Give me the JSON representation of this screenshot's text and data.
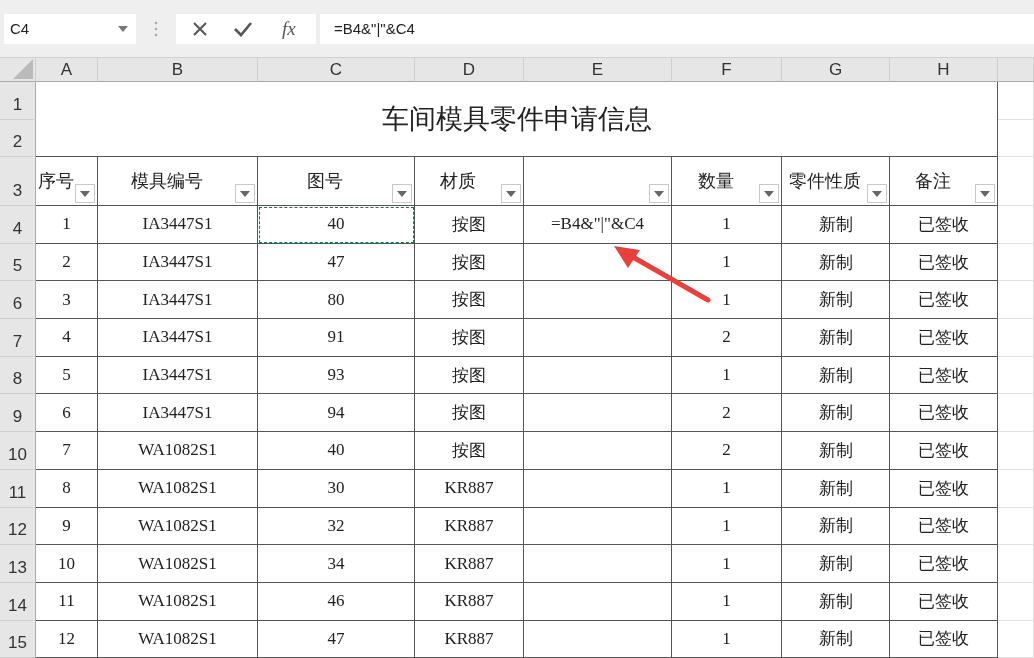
{
  "name_box": {
    "value": "C4"
  },
  "formula_bar": {
    "function_label": "fx",
    "formula": "=B4&\"|\"&C4"
  },
  "column_headers": [
    "A",
    "B",
    "C",
    "D",
    "E",
    "F",
    "G",
    "H"
  ],
  "row_headers": [
    "1",
    "2",
    "3",
    "4",
    "5",
    "6",
    "7",
    "8",
    "9",
    "10",
    "11",
    "12",
    "13",
    "14",
    "15"
  ],
  "title": "车间模具零件申请信息",
  "table": {
    "columns": [
      {
        "label": "序号"
      },
      {
        "label": "模具编号"
      },
      {
        "label": "图号"
      },
      {
        "label": "材质"
      },
      {},
      {
        "label": "数量"
      },
      {
        "label": "零件性质"
      },
      {
        "label": "备注"
      }
    ],
    "rows": [
      {
        "cells": [
          {
            "text": "1",
            "marquee": false
          },
          {
            "text": "IA3447S1",
            "marquee": false
          },
          {
            "text": "40",
            "marquee": true
          },
          {
            "text": "按图",
            "marquee": false
          },
          {
            "text": "=B4&\"|\"&C4",
            "marquee": false
          },
          {
            "text": "1",
            "marquee": false
          },
          {
            "text": "新制",
            "marquee": false
          },
          {
            "text": "已签收",
            "marquee": false
          }
        ]
      },
      {
        "cells": [
          {
            "text": "2",
            "marquee": false
          },
          {
            "text": "IA3447S1",
            "marquee": false
          },
          {
            "text": "47",
            "marquee": false
          },
          {
            "text": "按图",
            "marquee": false
          },
          {
            "marquee": false
          },
          {
            "text": "1",
            "marquee": false
          },
          {
            "text": "新制",
            "marquee": false
          },
          {
            "text": "已签收",
            "marquee": false
          }
        ]
      },
      {
        "cells": [
          {
            "text": "3",
            "marquee": false
          },
          {
            "text": "IA3447S1",
            "marquee": false
          },
          {
            "text": "80",
            "marquee": false
          },
          {
            "text": "按图",
            "marquee": false
          },
          {
            "marquee": false
          },
          {
            "text": "1",
            "marquee": false
          },
          {
            "text": "新制",
            "marquee": false
          },
          {
            "text": "已签收",
            "marquee": false
          }
        ]
      },
      {
        "cells": [
          {
            "text": "4",
            "marquee": false
          },
          {
            "text": "IA3447S1",
            "marquee": false
          },
          {
            "text": "91",
            "marquee": false
          },
          {
            "text": "按图",
            "marquee": false
          },
          {
            "marquee": false
          },
          {
            "text": "2",
            "marquee": false
          },
          {
            "text": "新制",
            "marquee": false
          },
          {
            "text": "已签收",
            "marquee": false
          }
        ]
      },
      {
        "cells": [
          {
            "text": "5",
            "marquee": false
          },
          {
            "text": "IA3447S1",
            "marquee": false
          },
          {
            "text": "93",
            "marquee": false
          },
          {
            "text": "按图",
            "marquee": false
          },
          {
            "marquee": false
          },
          {
            "text": "1",
            "marquee": false
          },
          {
            "text": "新制",
            "marquee": false
          },
          {
            "text": "已签收",
            "marquee": false
          }
        ]
      },
      {
        "cells": [
          {
            "text": "6",
            "marquee": false
          },
          {
            "text": "IA3447S1",
            "marquee": false
          },
          {
            "text": "94",
            "marquee": false
          },
          {
            "text": "按图",
            "marquee": false
          },
          {
            "marquee": false
          },
          {
            "text": "2",
            "marquee": false
          },
          {
            "text": "新制",
            "marquee": false
          },
          {
            "text": "已签收",
            "marquee": false
          }
        ]
      },
      {
        "cells": [
          {
            "text": "7",
            "marquee": false
          },
          {
            "text": "WA1082S1",
            "marquee": false
          },
          {
            "text": "40",
            "marquee": false
          },
          {
            "text": "按图",
            "marquee": false
          },
          {
            "marquee": false
          },
          {
            "text": "2",
            "marquee": false
          },
          {
            "text": "新制",
            "marquee": false
          },
          {
            "text": "已签收",
            "marquee": false
          }
        ]
      },
      {
        "cells": [
          {
            "text": "8",
            "marquee": false
          },
          {
            "text": "WA1082S1",
            "marquee": false
          },
          {
            "text": "30",
            "marquee": false
          },
          {
            "text": "KR887",
            "marquee": false
          },
          {
            "marquee": false
          },
          {
            "text": "1",
            "marquee": false
          },
          {
            "text": "新制",
            "marquee": false
          },
          {
            "text": "已签收",
            "marquee": false
          }
        ]
      },
      {
        "cells": [
          {
            "text": "9",
            "marquee": false
          },
          {
            "text": "WA1082S1",
            "marquee": false
          },
          {
            "text": "32",
            "marquee": false
          },
          {
            "text": "KR887",
            "marquee": false
          },
          {
            "marquee": false
          },
          {
            "text": "1",
            "marquee": false
          },
          {
            "text": "新制",
            "marquee": false
          },
          {
            "text": "已签收",
            "marquee": false
          }
        ]
      },
      {
        "cells": [
          {
            "text": "10",
            "marquee": false
          },
          {
            "text": "WA1082S1",
            "marquee": false
          },
          {
            "text": "34",
            "marquee": false
          },
          {
            "text": "KR887",
            "marquee": false
          },
          {
            "marquee": false
          },
          {
            "text": "1",
            "marquee": false
          },
          {
            "text": "新制",
            "marquee": false
          },
          {
            "text": "已签收",
            "marquee": false
          }
        ]
      },
      {
        "cells": [
          {
            "text": "11",
            "marquee": false
          },
          {
            "text": "WA1082S1",
            "marquee": false
          },
          {
            "text": "46",
            "marquee": false
          },
          {
            "text": "KR887",
            "marquee": false
          },
          {
            "marquee": false
          },
          {
            "text": "1",
            "marquee": false
          },
          {
            "text": "新制",
            "marquee": false
          },
          {
            "text": "已签收",
            "marquee": false
          }
        ]
      },
      {
        "cells": [
          {
            "text": "12",
            "marquee": false
          },
          {
            "text": "WA1082S1",
            "marquee": false
          },
          {
            "text": "47",
            "marquee": false
          },
          {
            "text": "KR887",
            "marquee": false
          },
          {
            "marquee": false
          },
          {
            "text": "1",
            "marquee": false
          },
          {
            "text": "新制",
            "marquee": false
          },
          {
            "text": "已签收",
            "marquee": false
          }
        ]
      }
    ]
  }
}
